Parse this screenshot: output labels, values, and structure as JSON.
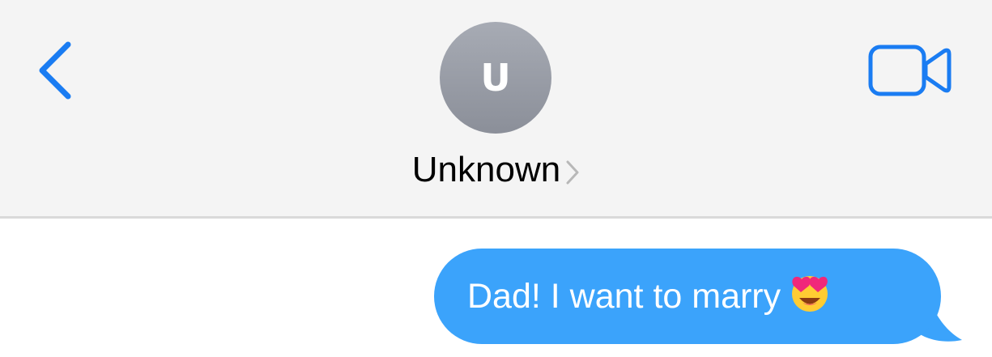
{
  "header": {
    "avatar_initial": "U",
    "contact_name": "Unknown",
    "back_icon": "chevron-left-icon",
    "video_icon": "video-camera-icon",
    "accent_color": "#1a7cf2",
    "background_color": "#f4f4f4"
  },
  "conversation": {
    "messages": [
      {
        "direction": "outgoing",
        "text": "Dad! I want to marry",
        "emoji": "heart-eyes-emoji",
        "bubble_color": "#3ba3fb"
      }
    ]
  }
}
